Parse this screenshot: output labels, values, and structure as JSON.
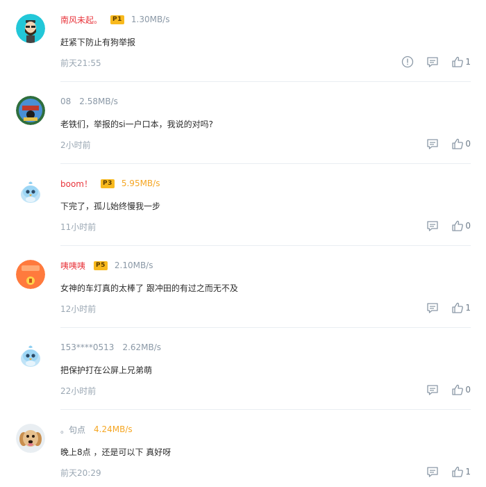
{
  "comments": [
    {
      "name": "南风未起。",
      "name_style": "red",
      "badge": "P1",
      "speed": "1.30MB/s",
      "speed_style": "gray",
      "text": "赶紧下防止有狗举报",
      "time": "前天21:55",
      "likes": "1",
      "has_report": true,
      "avatar": "avatar-cartoon-beard"
    },
    {
      "name": "08",
      "name_style": "gray",
      "badge": "",
      "speed": "2.58MB/s",
      "speed_style": "gray",
      "text": "老铁们，举报的si一户口本，我说的对吗?",
      "time": "2小时前",
      "likes": "0",
      "has_report": false,
      "avatar": "avatar-photo-circle"
    },
    {
      "name": "boom！",
      "name_style": "red",
      "badge": "P3",
      "speed": "5.95MB/s",
      "speed_style": "orange",
      "text": "下完了，孤儿始终慢我一步",
      "time": "11小时前",
      "likes": "0",
      "has_report": false,
      "avatar": "avatar-blue-bird"
    },
    {
      "name": "咦咦咦",
      "name_style": "red",
      "badge": "P5",
      "speed": "2.10MB/s",
      "speed_style": "gray",
      "text": "女神的车灯真的太棒了  跟冲田的有过之而无不及",
      "time": "12小时前",
      "likes": "1",
      "has_report": false,
      "avatar": "avatar-orange-envelope"
    },
    {
      "name": "153****0513",
      "name_style": "gray",
      "badge": "",
      "speed": "2.62MB/s",
      "speed_style": "gray",
      "text": "把保护打在公屏上兄弟萌",
      "time": "22小时前",
      "likes": "0",
      "has_report": false,
      "avatar": "avatar-blue-bird"
    },
    {
      "name": "。句点",
      "name_style": "gray",
      "badge": "",
      "speed": "4.24MB/s",
      "speed_style": "orange",
      "text": "晚上8点 ，还是可以下 真好呀",
      "time": "前天20:29",
      "likes": "1",
      "has_report": false,
      "avatar": "avatar-puppy"
    }
  ],
  "colors": {
    "red_name": "#e8343b",
    "gray_text": "#8a98a6",
    "orange_speed": "#f5a623",
    "badge_bg": "#f8b91d",
    "divider": "#e9edf2"
  }
}
